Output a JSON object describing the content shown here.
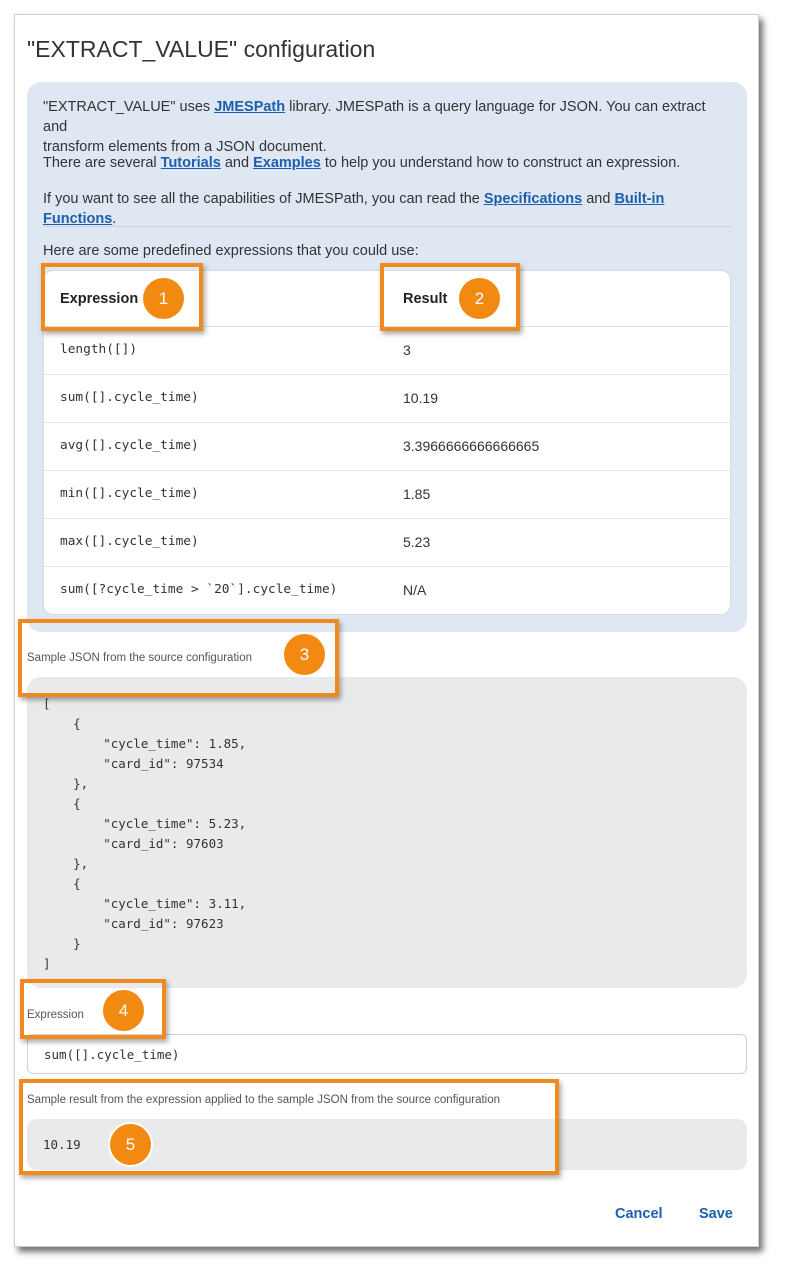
{
  "dialog": {
    "title": "\"EXTRACT_VALUE\" configuration"
  },
  "info": {
    "p1_pre": "\"EXTRACT_VALUE\" uses ",
    "p1_link": "JMESPath",
    "p1_post1": " library. JMESPath is a query language for JSON. You can extract and",
    "p1_post2": "transform elements from a JSON document.",
    "p2_pre": "There are several ",
    "p2_link1": "Tutorials",
    "p2_mid": " and ",
    "p2_link2": "Examples",
    "p2_post": " to help you understand how to construct an expression.",
    "p3_pre": "If you want to see all the capabilities of JMESPath, you can read the ",
    "p3_link1": "Specifications",
    "p3_mid": " and ",
    "p3_link2": "Built-in Functions",
    "p3_post": ".",
    "predefined_intro": "Here are some predefined expressions that you could use:"
  },
  "table": {
    "col_expression": "Expression",
    "col_result": "Result",
    "rows": [
      {
        "expression": "length([])",
        "result": "3"
      },
      {
        "expression": "sum([].cycle_time)",
        "result": "10.19"
      },
      {
        "expression": "avg([].cycle_time)",
        "result": "3.3966666666666665"
      },
      {
        "expression": "min([].cycle_time)",
        "result": "1.85"
      },
      {
        "expression": "max([].cycle_time)",
        "result": "5.23"
      },
      {
        "expression": "sum([?cycle_time > `20`].cycle_time)",
        "result": "N/A"
      }
    ]
  },
  "sample_json": {
    "label": "Sample JSON from the source configuration",
    "lines": [
      "[",
      "    {",
      "        \"cycle_time\": 1.85,",
      "        \"card_id\": 97534",
      "    },",
      "    {",
      "        \"cycle_time\": 5.23,",
      "        \"card_id\": 97603",
      "    },",
      "    {",
      "        \"cycle_time\": 3.11,",
      "        \"card_id\": 97623",
      "    }",
      "]"
    ]
  },
  "expression": {
    "label": "Expression",
    "value": "sum([].cycle_time)"
  },
  "sample_result": {
    "label": "Sample result from the expression applied to the sample JSON from the source configuration",
    "value": "10.19"
  },
  "buttons": {
    "cancel": "Cancel",
    "save": "Save"
  },
  "callouts": [
    "1",
    "2",
    "3",
    "4",
    "5"
  ],
  "colors": {
    "accent": "#f28a12",
    "link": "#1b5fae",
    "panel": "#dfe7f3",
    "code_bg": "#e9eaec"
  }
}
